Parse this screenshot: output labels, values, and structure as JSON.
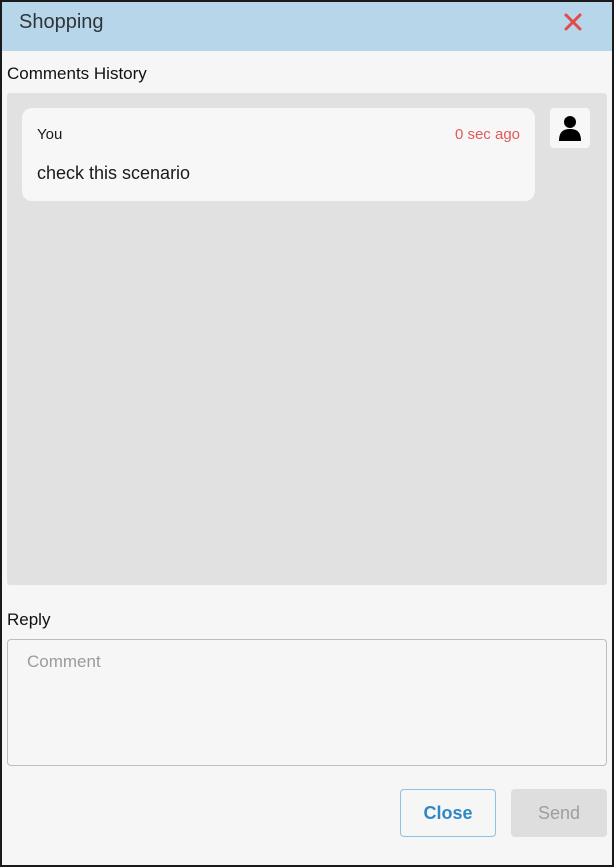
{
  "dialog": {
    "title": "Shopping",
    "close_icon": "close-x-icon",
    "accent_color": "#e24b4b",
    "header_color": "#b8d6ea"
  },
  "history": {
    "label": "Comments History",
    "comments": [
      {
        "author": "You",
        "time": "0 sec ago",
        "text": "check this scenario",
        "avatar_icon": "user-icon"
      }
    ]
  },
  "reply": {
    "label": "Reply",
    "placeholder": "Comment",
    "value": ""
  },
  "actions": {
    "close_label": "Close",
    "send_label": "Send"
  }
}
